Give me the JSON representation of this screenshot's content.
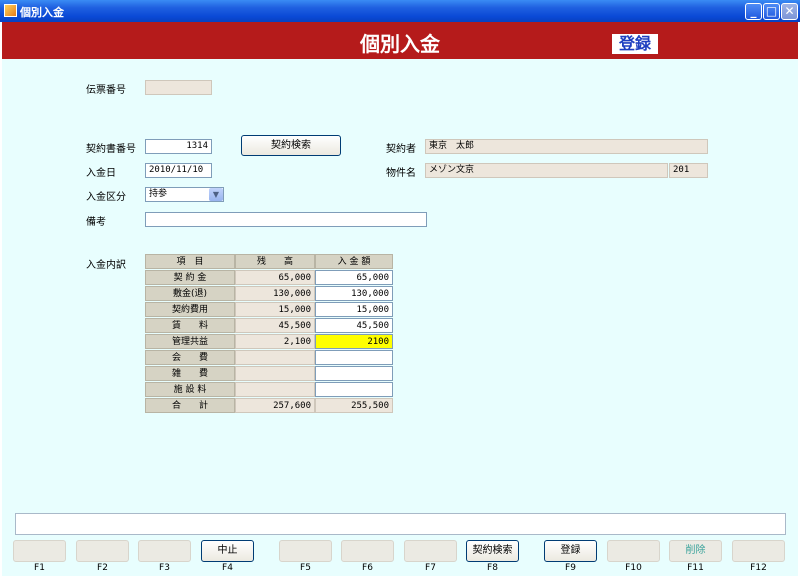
{
  "window": {
    "title": "個別入金"
  },
  "header": {
    "title": "個別入金",
    "mode_badge": "登録"
  },
  "form": {
    "slip_no_label": "伝票番号",
    "slip_no_value": "",
    "contract_no_label": "契約書番号",
    "contract_no_value": "1314",
    "contract_search_button": "契約検索",
    "contractor_label": "契約者",
    "contractor_value": "東京　太郎",
    "payment_date_label": "入金日",
    "payment_date_value": "2010/11/10",
    "property_label": "物件名",
    "property_value": "メゾン文京",
    "room_no_value": "201",
    "payment_type_label": "入金区分",
    "payment_type_value": "持参",
    "memo_label": "備考",
    "memo_value": ""
  },
  "breakdown": {
    "label": "入金内訳",
    "headers": [
      "項　目",
      "残　　高",
      "入 金 額"
    ],
    "rows": [
      {
        "item": "契 約 金",
        "balance": "65,000",
        "payment": "65,000"
      },
      {
        "item": "敷金(退)",
        "balance": "130,000",
        "payment": "130,000"
      },
      {
        "item": "契約費用",
        "balance": "15,000",
        "payment": "15,000"
      },
      {
        "item": "賃　　料",
        "balance": "45,500",
        "payment": "45,500"
      },
      {
        "item": "管理共益",
        "balance": "2,100",
        "payment": "2100"
      },
      {
        "item": "会　　費",
        "balance": "",
        "payment": ""
      },
      {
        "item": "雑　　費",
        "balance": "",
        "payment": ""
      },
      {
        "item": "施 設 料",
        "balance": "",
        "payment": ""
      }
    ],
    "total": {
      "item": "合　　計",
      "balance": "257,600",
      "payment": "255,500"
    },
    "highlight_color": "#ffff00"
  },
  "footer": {
    "message": "",
    "fkeys": [
      {
        "key": "F1",
        "label": ""
      },
      {
        "key": "F2",
        "label": ""
      },
      {
        "key": "F3",
        "label": ""
      },
      {
        "key": "F4",
        "label": "中止"
      },
      {
        "key": "F5",
        "label": ""
      },
      {
        "key": "F6",
        "label": ""
      },
      {
        "key": "F7",
        "label": ""
      },
      {
        "key": "F8",
        "label": "契約検索"
      },
      {
        "key": "F9",
        "label": "登録"
      },
      {
        "key": "F10",
        "label": ""
      },
      {
        "key": "F11",
        "label": "削除"
      },
      {
        "key": "F12",
        "label": ""
      }
    ]
  },
  "colors": {
    "header": "#b51b1b",
    "background": "#e8fefe",
    "badge_text": "#1e3fc0"
  }
}
